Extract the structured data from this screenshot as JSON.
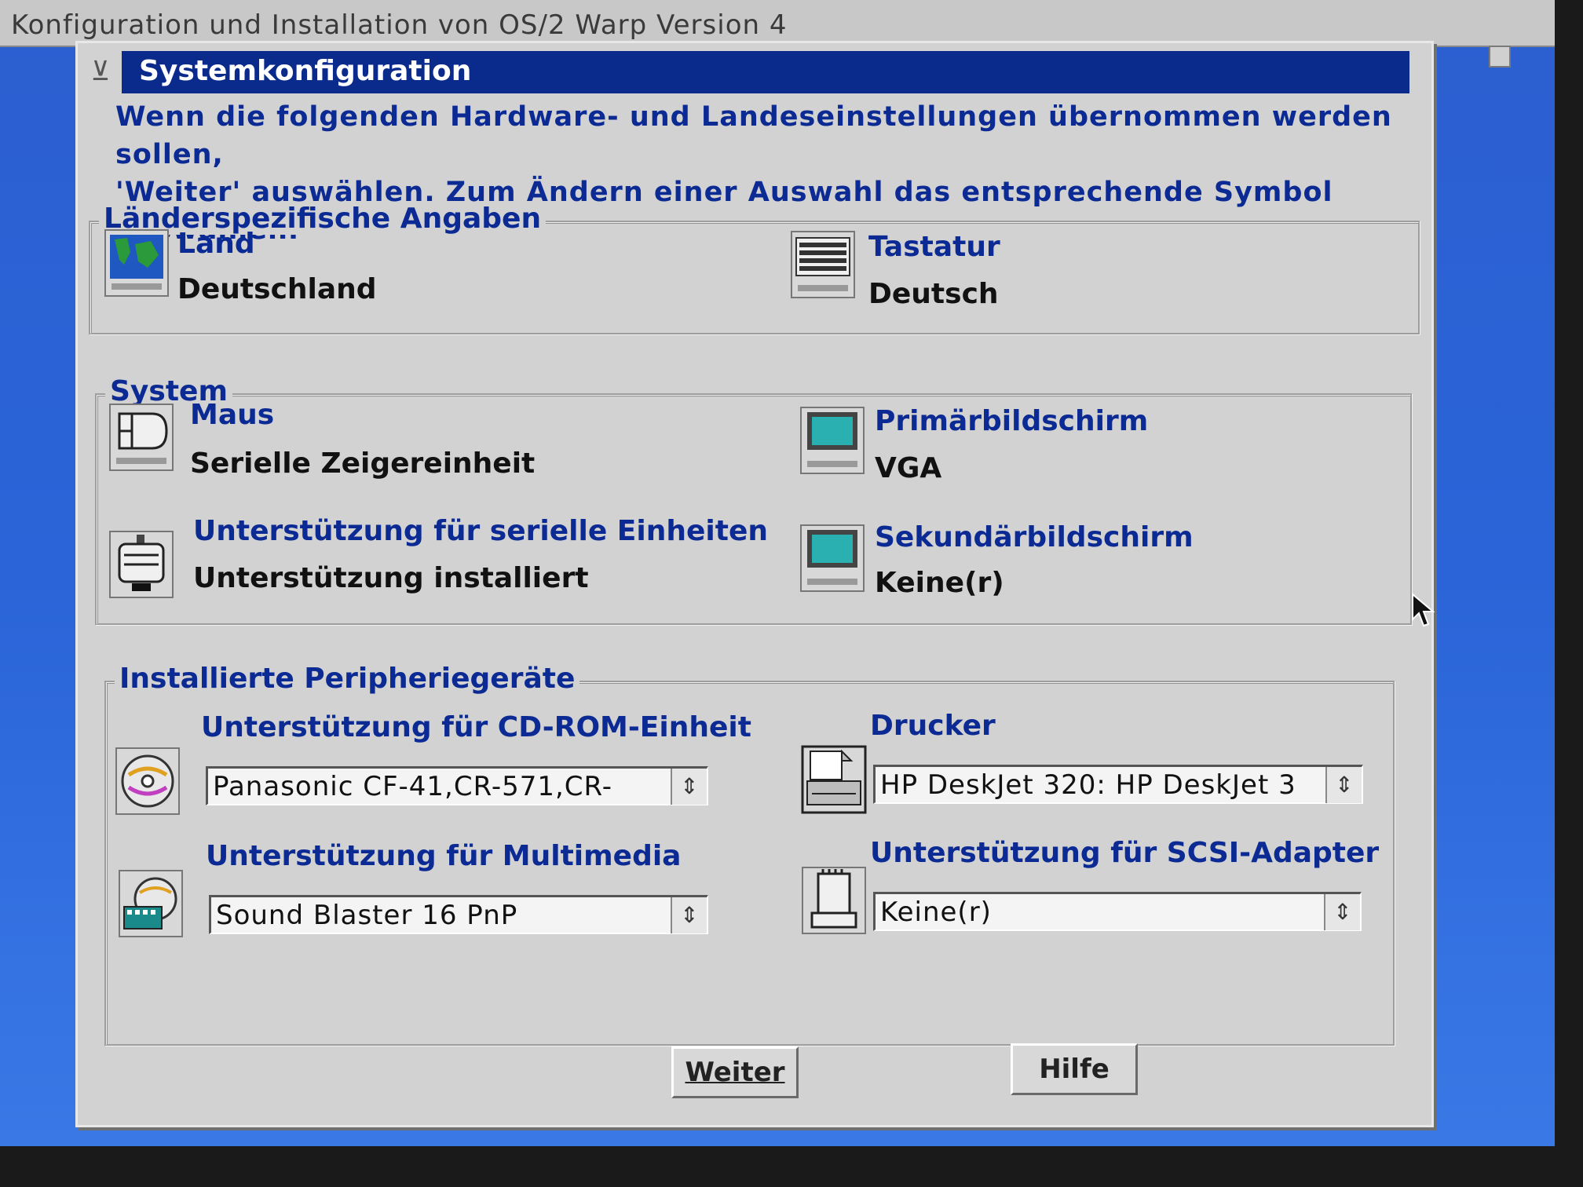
{
  "window": {
    "outer_title": "Konfiguration und Installation von OS/2 Warp Version 4",
    "dialog_title": "Systemkonfiguration"
  },
  "intro": {
    "line1": "Wenn die folgenden Hardware- und Landeseinstellungen übernommen werden sollen,",
    "line2": "'Weiter' auswählen. Zum Ändern einer Auswahl das entsprechende Symbol auswählen."
  },
  "country_group": {
    "title": "Länderspezifische Angaben",
    "country": {
      "label": "Land",
      "value": "Deutschland",
      "icon": "globe-icon"
    },
    "keyboard": {
      "label": "Tastatur",
      "value": "Deutsch",
      "icon": "keyboard-icon"
    }
  },
  "system_group": {
    "title": "System",
    "mouse": {
      "label": "Maus",
      "value": "Serielle Zeigereinheit",
      "icon": "mouse-icon"
    },
    "primary_display": {
      "label": "Primärbildschirm",
      "value": "VGA",
      "icon": "monitor-icon"
    },
    "serial": {
      "label": "Unterstützung für serielle Einheiten",
      "value": "Unterstützung installiert",
      "icon": "serial-port-icon"
    },
    "secondary_display": {
      "label": "Sekundärbildschirm",
      "value": "Keine(r)",
      "icon": "monitor-icon"
    }
  },
  "peripherals_group": {
    "title": "Installierte Peripheriegeräte",
    "cdrom": {
      "label": "Unterstützung für CD-ROM-Einheit",
      "value": "Panasonic CF-41,CR-571,CR-",
      "icon": "cdrom-icon"
    },
    "printer": {
      "label": "Drucker",
      "value": "HP DeskJet 320: HP DeskJet 3",
      "icon": "printer-icon"
    },
    "multimedia": {
      "label": "Unterstützung für Multimedia",
      "value": "Sound Blaster 16 PnP",
      "icon": "multimedia-icon"
    },
    "scsi": {
      "label": "Unterstützung für SCSI-Adapter",
      "value": "Keine(r)",
      "icon": "scsi-adapter-icon"
    }
  },
  "buttons": {
    "next": "Weiter",
    "help": "Hilfe"
  },
  "colors": {
    "title_bar": "#0a2a8c",
    "label_text": "#0b2a94",
    "dialog_bg": "#d2d2d2",
    "desktop": "#2a64d8"
  }
}
